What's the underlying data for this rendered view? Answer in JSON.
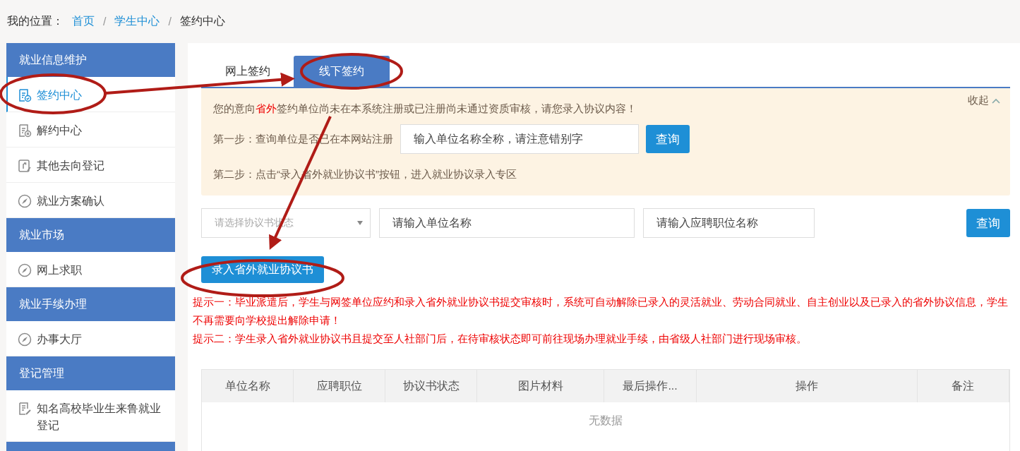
{
  "breadcrumb": {
    "label": "我的位置：",
    "links": [
      "首页",
      "学生中心"
    ],
    "separator": "/",
    "current": "签约中心"
  },
  "sidebar": {
    "groups": [
      {
        "title": "就业信息维护",
        "items": [
          {
            "label": "签约中心",
            "kind": "sign",
            "selected": true
          },
          {
            "label": "解约中心",
            "kind": "cancel",
            "selected": false
          },
          {
            "label": "其他去向登记",
            "kind": "other",
            "selected": false
          },
          {
            "label": "就业方案确认",
            "kind": "compass",
            "selected": false
          }
        ]
      },
      {
        "title": "就业市场",
        "items": [
          {
            "label": "网上求职",
            "kind": "compass",
            "selected": false
          }
        ]
      },
      {
        "title": "就业手续办理",
        "items": [
          {
            "label": "办事大厅",
            "kind": "compass",
            "selected": false
          }
        ]
      },
      {
        "title": "登记管理",
        "items": [
          {
            "label": "知名高校毕业生来鲁就业登记",
            "kind": "register",
            "selected": false
          }
        ]
      }
    ]
  },
  "tabs": [
    {
      "label": "网上签约",
      "selected": false
    },
    {
      "label": "线下签约",
      "selected": true
    }
  ],
  "notice": {
    "collapse": "收起",
    "message": [
      {
        "text": "您的意向",
        "emphasis": false
      },
      {
        "text": "省外",
        "emphasis": true
      },
      {
        "text": "签约单位尚未在本系统注册或已注册尚未通过资质审核，请您录入协议内容！",
        "emphasis": false
      }
    ],
    "step1": "第一步：查询单位是否已在本网站注册",
    "step1_placeholder": "输入单位名称全称，请注意错别字",
    "step1_button": "查询",
    "step2": "第二步：点击“录入省外就业协议书”按钮，进入就业协议录入专区"
  },
  "filters": {
    "status_placeholder": "请选择协议书状态",
    "company_placeholder": "请输入单位名称",
    "position_placeholder": "请输入应聘职位名称",
    "search_button": "查询"
  },
  "add_button": "录入省外就业协议书",
  "tips": [
    "提示一：毕业派遣后，学生与网签单位应约和录入省外就业协议书提交审核时，系统可自动解除已录入的灵活就业、劳动合同就业、自主创业以及已录入的省外协议信息，学生不再需要向学校提出解除申请！",
    "提示二：学生录入省外就业协议书且提交至人社部门后，在待审核状态即可前往现场办理就业手续，由省级人社部门进行现场审核。"
  ],
  "table": {
    "columns": [
      "单位名称",
      "应聘职位",
      "协议书状态",
      "图片材料",
      "最后操作...",
      "操作",
      "备注"
    ],
    "empty": "无数据"
  }
}
